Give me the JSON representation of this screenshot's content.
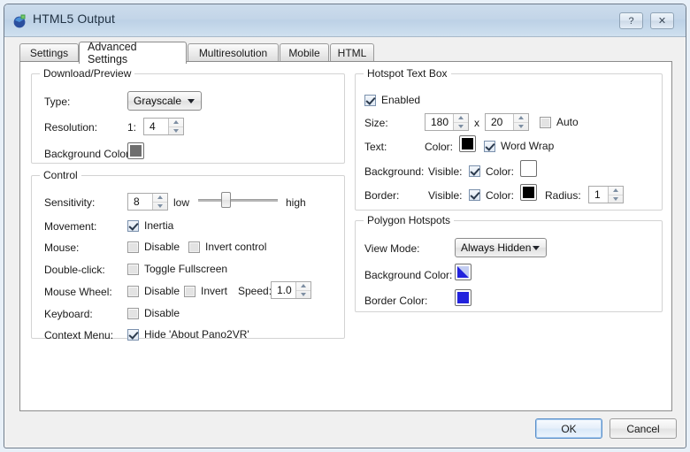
{
  "window": {
    "title": "HTML5 Output",
    "icon": "pano2vr-logo-icon",
    "help_label": "?",
    "close_label": "✕"
  },
  "tabs": [
    {
      "label": "Settings",
      "active": false
    },
    {
      "label": "Advanced Settings",
      "active": true
    },
    {
      "label": "Multiresolution",
      "active": false
    },
    {
      "label": "Mobile",
      "active": false
    },
    {
      "label": "HTML",
      "active": false
    }
  ],
  "download_preview": {
    "legend": "Download/Preview",
    "type_label": "Type:",
    "type_value": "Grayscale",
    "resolution_label": "Resolution:",
    "resolution_prefix": "1:",
    "resolution_value": "4",
    "background_color_label": "Background Color:",
    "background_color_value": "#6e6e6e"
  },
  "control": {
    "legend": "Control",
    "sensitivity_label": "Sensitivity:",
    "sensitivity_value": "8",
    "slider_low": "low",
    "slider_high": "high",
    "slider_percent": 33,
    "movement_label": "Movement:",
    "inertia_label": "Inertia",
    "inertia_checked": true,
    "mouse_label": "Mouse:",
    "mouse_disable_label": "Disable",
    "mouse_disable_checked": false,
    "mouse_invert_label": "Invert control",
    "mouse_invert_checked": false,
    "double_click_label": "Double-click:",
    "toggle_fullscreen_label": "Toggle Fullscreen",
    "toggle_fullscreen_checked": false,
    "mouse_wheel_label": "Mouse Wheel:",
    "wheel_disable_label": "Disable",
    "wheel_disable_checked": false,
    "wheel_invert_label": "Invert",
    "wheel_invert_checked": false,
    "wheel_speed_label": "Speed:",
    "wheel_speed_value": "1.0",
    "keyboard_label": "Keyboard:",
    "keyboard_disable_label": "Disable",
    "keyboard_disable_checked": false,
    "context_menu_label": "Context Menu:",
    "hide_about_label": "Hide 'About Pano2VR'",
    "hide_about_checked": true
  },
  "hotspot_text_box": {
    "legend": "Hotspot Text Box",
    "enabled_label": "Enabled",
    "enabled_checked": true,
    "size_label": "Size:",
    "size_width": "180",
    "size_separator": "x",
    "size_height": "20",
    "auto_label": "Auto",
    "auto_checked": false,
    "text_label": "Text:",
    "text_color_label": "Color:",
    "text_color_value": "#000000",
    "word_wrap_label": "Word Wrap",
    "word_wrap_checked": true,
    "background_label": "Background:",
    "background_visible_label": "Visible:",
    "background_visible_checked": true,
    "background_color_label": "Color:",
    "background_color_value": "#ffffff",
    "border_label": "Border:",
    "border_visible_label": "Visible:",
    "border_visible_checked": true,
    "border_color_label": "Color:",
    "border_color_value": "#000000",
    "radius_label": "Radius:",
    "radius_value": "1"
  },
  "polygon_hotspots": {
    "legend": "Polygon Hotspots",
    "view_mode_label": "View Mode:",
    "view_mode_value": "Always Hidden",
    "background_color_label": "Background Color:",
    "background_color_value": "#2222dd",
    "border_color_label": "Border Color:",
    "border_color_value": "#2222dd"
  },
  "footer": {
    "ok_label": "OK",
    "cancel_label": "Cancel"
  }
}
